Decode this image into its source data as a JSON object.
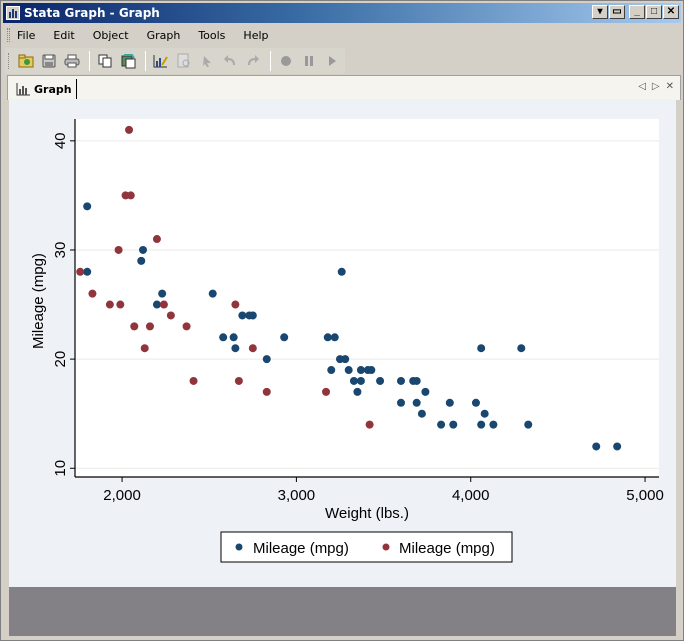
{
  "window": {
    "title": "Stata Graph - Graph",
    "controls": [
      "dropdown",
      "restore-doc",
      "minimize",
      "maximize",
      "close"
    ]
  },
  "menu": {
    "items": [
      {
        "label": "File",
        "accel": "F"
      },
      {
        "label": "Edit",
        "accel": "E"
      },
      {
        "label": "Object",
        "accel": "O"
      },
      {
        "label": "Graph",
        "accel": "G"
      },
      {
        "label": "Tools",
        "accel": "T"
      },
      {
        "label": "Help",
        "accel": "H"
      }
    ]
  },
  "toolbar": {
    "buttons": [
      {
        "name": "open-graph",
        "icon": "folder-open-icon",
        "enabled": true
      },
      {
        "name": "save-graph",
        "icon": "floppy-disk-icon",
        "enabled": true
      },
      {
        "name": "print-graph",
        "icon": "printer-icon",
        "enabled": true
      },
      {
        "name": "copy-graph",
        "icon": "copy-icon",
        "enabled": true
      },
      {
        "name": "apply-scheme",
        "icon": "rename-icon",
        "enabled": true
      },
      {
        "name": "graph-editor",
        "icon": "chart-edit-icon",
        "enabled": true
      },
      {
        "name": "object-browser",
        "icon": "document-search-icon",
        "enabled": false
      },
      {
        "name": "pointer-tool",
        "icon": "pointer-icon",
        "enabled": false
      },
      {
        "name": "undo",
        "icon": "undo-icon",
        "enabled": false
      },
      {
        "name": "redo",
        "icon": "redo-icon",
        "enabled": false
      },
      {
        "name": "record",
        "icon": "record-icon",
        "enabled": false
      },
      {
        "name": "pause",
        "icon": "pause-icon",
        "enabled": false
      },
      {
        "name": "play",
        "icon": "play-icon",
        "enabled": false
      }
    ]
  },
  "tabs": {
    "active": "Graph",
    "items": [
      {
        "label": "Graph",
        "icon": "bar-chart-icon"
      }
    ]
  },
  "colors": {
    "series_blue": "#1a476f",
    "series_red": "#90353b",
    "plot_bg": "#ffffff",
    "graph_bg": "#eef1f6",
    "grid": "#eaeaea"
  },
  "chart_data": {
    "type": "scatter",
    "title": "",
    "xlabel": "Weight (lbs.)",
    "ylabel": "Mileage (mpg)",
    "xlim": [
      1730,
      5080
    ],
    "ylim": [
      9.2,
      42
    ],
    "xticks": [
      2000,
      3000,
      4000,
      5000
    ],
    "xtick_labels": [
      "2,000",
      "3,000",
      "4,000",
      "5,000"
    ],
    "yticks": [
      10,
      20,
      30,
      40
    ],
    "ytick_labels": [
      "10",
      "20",
      "30",
      "40"
    ],
    "grid": "horizontal",
    "legend_position": "bottom",
    "series": [
      {
        "name": "Mileage (mpg)",
        "color": "#1a476f",
        "points": [
          [
            1800,
            34
          ],
          [
            1800,
            28
          ],
          [
            2110,
            29
          ],
          [
            2120,
            30
          ],
          [
            2230,
            26
          ],
          [
            2200,
            25
          ],
          [
            2520,
            26
          ],
          [
            2580,
            22
          ],
          [
            2640,
            22
          ],
          [
            2650,
            21
          ],
          [
            2690,
            24
          ],
          [
            2730,
            24
          ],
          [
            2750,
            24
          ],
          [
            2830,
            20
          ],
          [
            2930,
            22
          ],
          [
            3260,
            28
          ],
          [
            3180,
            22
          ],
          [
            3220,
            22
          ],
          [
            3250,
            20
          ],
          [
            3280,
            20
          ],
          [
            3200,
            19
          ],
          [
            3300,
            19
          ],
          [
            3370,
            19
          ],
          [
            3410,
            19
          ],
          [
            3430,
            19
          ],
          [
            3330,
            18
          ],
          [
            3370,
            18
          ],
          [
            3480,
            18
          ],
          [
            3350,
            17
          ],
          [
            3600,
            18
          ],
          [
            3670,
            18
          ],
          [
            3690,
            18
          ],
          [
            3740,
            17
          ],
          [
            3600,
            16
          ],
          [
            3690,
            16
          ],
          [
            3880,
            16
          ],
          [
            4030,
            16
          ],
          [
            3720,
            15
          ],
          [
            4080,
            15
          ],
          [
            3830,
            14
          ],
          [
            3900,
            14
          ],
          [
            4060,
            14
          ],
          [
            4130,
            14
          ],
          [
            4330,
            14
          ],
          [
            4060,
            21
          ],
          [
            4290,
            21
          ],
          [
            4720,
            12
          ],
          [
            4840,
            12
          ]
        ]
      },
      {
        "name": "Mileage (mpg)",
        "color": "#90353b",
        "points": [
          [
            2040,
            41
          ],
          [
            2020,
            35
          ],
          [
            2050,
            35
          ],
          [
            2200,
            31
          ],
          [
            1980,
            30
          ],
          [
            1760,
            28
          ],
          [
            1830,
            26
          ],
          [
            1930,
            25
          ],
          [
            1990,
            25
          ],
          [
            2240,
            25
          ],
          [
            2650,
            25
          ],
          [
            2280,
            24
          ],
          [
            2070,
            23
          ],
          [
            2160,
            23
          ],
          [
            2370,
            23
          ],
          [
            2130,
            21
          ],
          [
            2750,
            21
          ],
          [
            2410,
            18
          ],
          [
            2670,
            18
          ],
          [
            2830,
            17
          ],
          [
            3170,
            17
          ],
          [
            3420,
            14
          ]
        ]
      }
    ]
  }
}
